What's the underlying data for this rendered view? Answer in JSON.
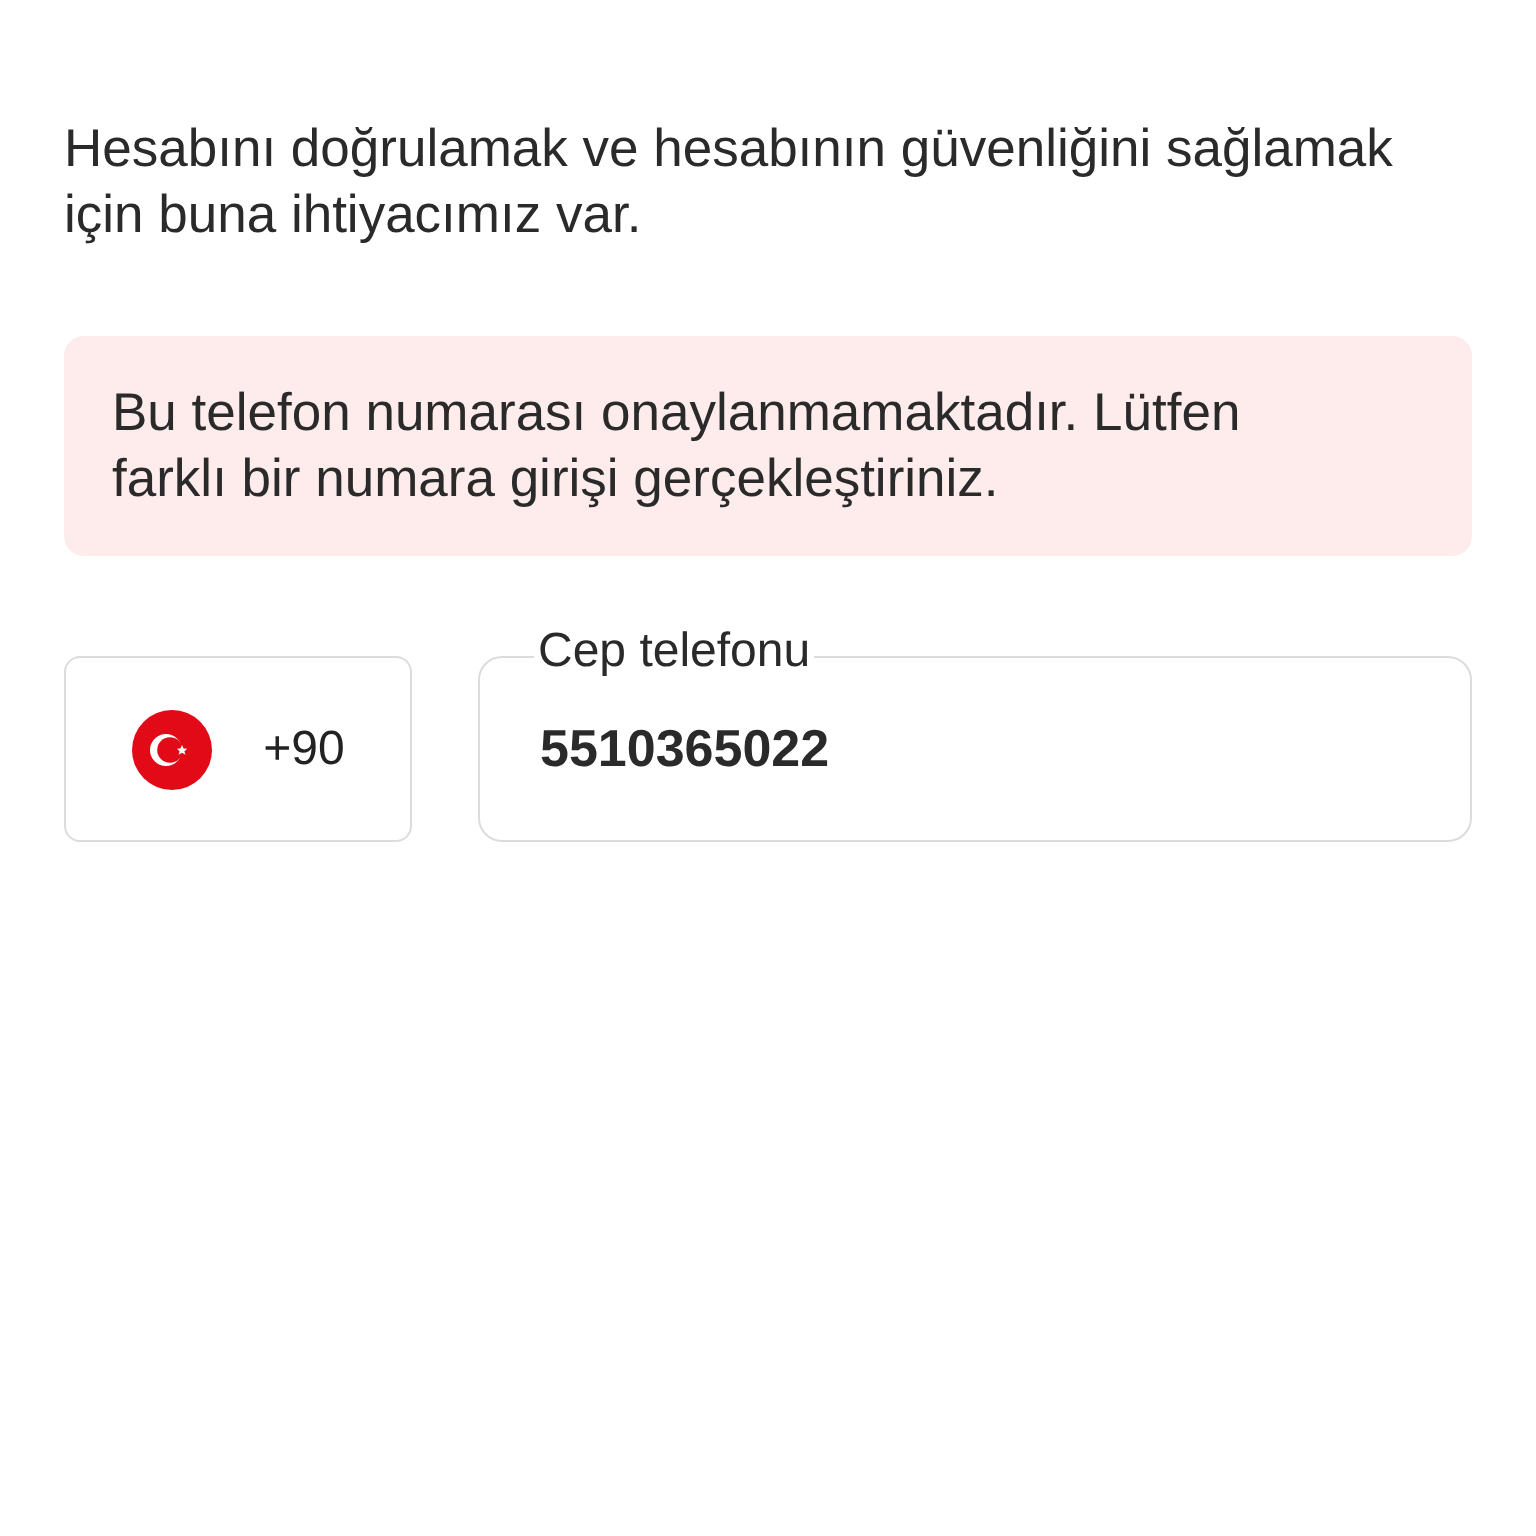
{
  "description": "Hesabını doğrulamak ve hesabının güvenliğini sağlamak için buna ihtiyacımız var.",
  "alert": {
    "kind": "error",
    "message": "Bu telefon numarası onaylanmamaktadır. Lütfen farklı bir numara girişi gerçekleştiriniz."
  },
  "country_code": {
    "code": "+90"
  },
  "phone_field": {
    "label": "Cep telefonu",
    "value": "5510365022"
  }
}
